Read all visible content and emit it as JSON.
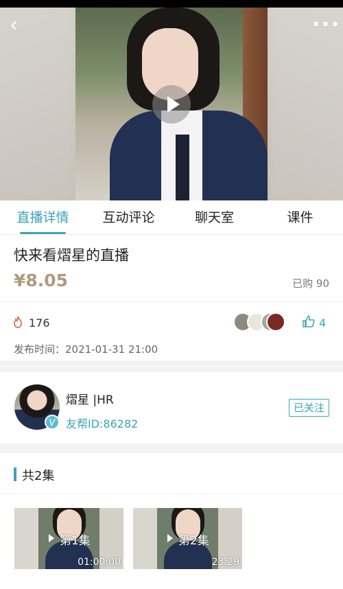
{
  "nav": {
    "back_icon": "back-arrow-icon",
    "more_icon": "more-dots-icon"
  },
  "tabs": [
    {
      "label": "直播详情",
      "active": true
    },
    {
      "label": "互动评论",
      "active": false
    },
    {
      "label": "聊天室",
      "active": false
    },
    {
      "label": "课件",
      "active": false
    }
  ],
  "detail": {
    "title": "快来看熠星的直播",
    "price": "¥8.05",
    "sold": "已购 90",
    "heat": "176",
    "likes": "4",
    "publish_time": "发布时间：2021-01-31 21:00"
  },
  "host": {
    "name": "熠星 |HR",
    "id": "友帮ID:86282",
    "badge": "V",
    "follow_label": "已关注"
  },
  "episodes": {
    "title": "共2集",
    "items": [
      {
        "label": "第1集",
        "duration": "01:00:00"
      },
      {
        "label": "第2集",
        "duration": "23:29"
      }
    ]
  },
  "colors": {
    "accent": "#3aa3b8",
    "price": "#b19a80",
    "fire": "#e25a4d"
  }
}
